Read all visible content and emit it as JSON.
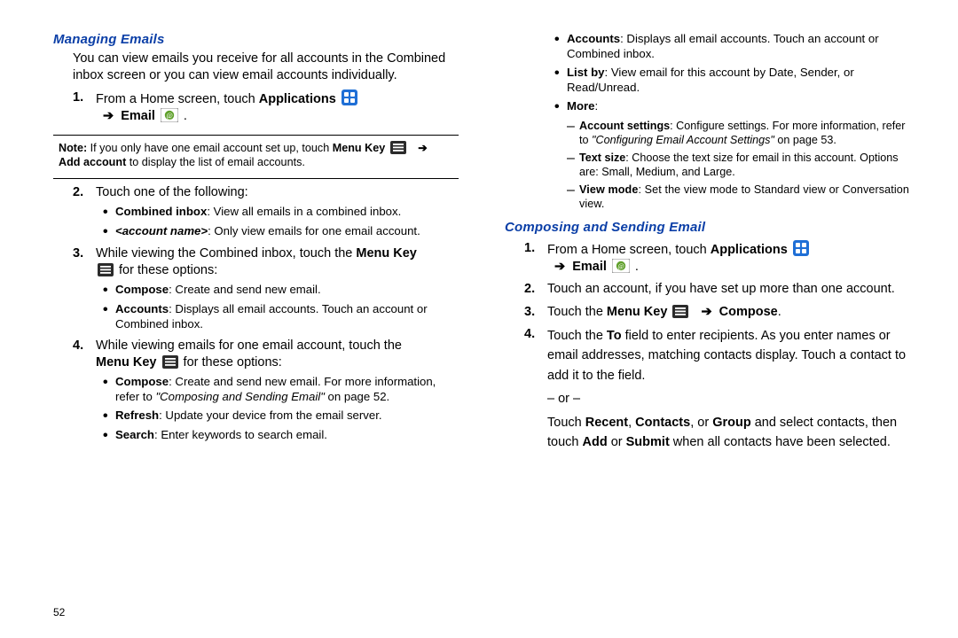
{
  "page_number": "52",
  "left": {
    "h1": "Managing Emails",
    "intro": "You can view emails you receive for all accounts in the Combined inbox screen or you can view email accounts individually.",
    "s1_a": "From a Home screen, touch ",
    "s1_apps": "Applications",
    "s1_email": "Email",
    "note_prefix": "Note:",
    "note_a": " If you only have one email account set up, touch ",
    "note_menu": "Menu Key",
    "note_b": "Add account",
    "note_c": " to display the list of email accounts.",
    "s2": "Touch one of the following:",
    "s2_b1_b": "Combined inbox",
    "s2_b1_t": ": View all emails in a combined inbox.",
    "s2_b2_i": "<account name>",
    "s2_b2_t": ": Only view emails for one email account.",
    "s3_a": "While viewing the Combined inbox, touch the ",
    "s3_menu": "Menu Key",
    "s3_b": " for these options:",
    "s3_b1_b": "Compose",
    "s3_b1_t": ": Create and send new email.",
    "s3_b2_b": "Accounts",
    "s3_b2_t": ": Displays all email accounts. Touch an account or Combined inbox.",
    "s4_a": "While viewing emails for one email account, touch the ",
    "s4_menu": "Menu Key",
    "s4_b": " for these options:",
    "s4_b1_b": "Compose",
    "s4_b1_t": ": Create and send new email. For more information, refer to ",
    "s4_b1_ref": "\"Composing and Sending Email\"",
    "s4_b1_pg": "  on page 52.",
    "s4_b2_b": "Refresh",
    "s4_b2_t": ": Update your device from the email server.",
    "s4_b3_b": "Search",
    "s4_b3_t": ": Enter keywords to search email."
  },
  "right": {
    "r_b1_b": "Accounts",
    "r_b1_t": ": Displays all email accounts. Touch an account or Combined inbox.",
    "r_b2_b": "List by",
    "r_b2_t": ": View email for this account by Date, Sender, or Read/Unread.",
    "r_b3_b": "More",
    "r_b3_t": ":",
    "r_d1_b": "Account settings",
    "r_d1_t": ": Configure settings. For more information, refer to ",
    "r_d1_ref": "\"Configuring Email Account Settings\"",
    "r_d1_pg": "  on page 53.",
    "r_d2_b": "Text size",
    "r_d2_t": ": Choose the text size for email in this account. Options are: Small, Medium, and Large.",
    "r_d3_b": "View mode",
    "r_d3_t": ": Set the view mode to Standard view or Conversation view.",
    "h2": "Composing and Sending Email",
    "c1_a": "From a Home screen, touch ",
    "c1_apps": "Applications",
    "c1_email": "Email",
    "c2": "Touch an account, if you have set up more than one account.",
    "c3_a": "Touch the ",
    "c3_menu": "Menu Key",
    "c3_compose": "Compose",
    "c4_a": "Touch the ",
    "c4_to": "To",
    "c4_b": " field to enter recipients. As you enter names or email addresses, matching contacts display. Touch a contact to add it to the field.",
    "c4_or": "– or –",
    "c4_c1": "Touch ",
    "c4_recent": "Recent",
    "c4_contacts": "Contacts",
    "c4_group": "Group",
    "c4_c2": " and select contacts, then touch ",
    "c4_add": "Add",
    "c4_submit": "Submit",
    "c4_c3": " when all contacts have been selected."
  }
}
